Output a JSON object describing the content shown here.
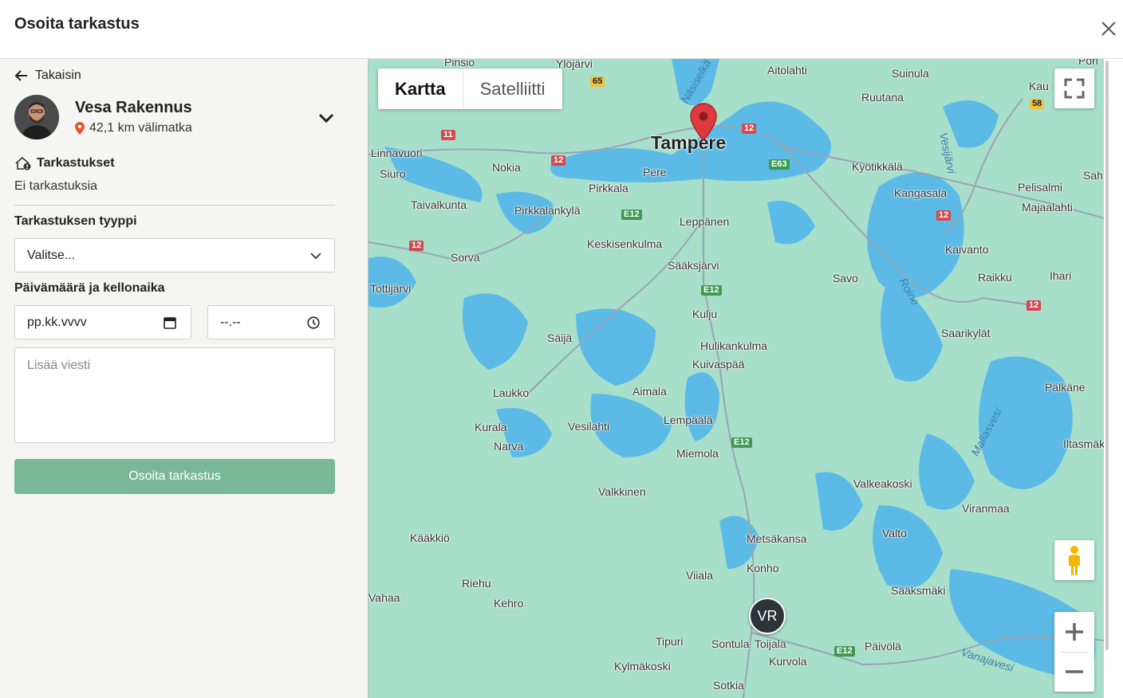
{
  "modal": {
    "title": "Osoita tarkastus"
  },
  "back": {
    "label": "Takaisin"
  },
  "profile": {
    "name": "Vesa Rakennus",
    "distance": "42,1 km välimatka"
  },
  "inspections": {
    "heading": "Tarkastukset",
    "empty_text": "Ei tarkastuksia"
  },
  "form": {
    "type_label": "Tarkastuksen tyyppi",
    "type_value": "Valitse...",
    "datetime_label": "Päivämäärä ja kellonaika",
    "date_placeholder": "pp.kk.vvvv",
    "time_placeholder": "--.--",
    "message_placeholder": "Lisää viesti",
    "submit_label": "Osoita tarkastus"
  },
  "map": {
    "tab_map": "Kartta",
    "tab_satellite": "Satelliitti",
    "marker_initials": "VR",
    "place_labels": [
      "Pinsio",
      "Ylöjärvi",
      "Aitolahti",
      "Suinula",
      "Ruutana",
      "Tampere",
      "Linnavuori",
      "Nokia",
      "Pere",
      "Kyötikkälä",
      "Siuro",
      "Pirkkala",
      "Kangasala",
      "Pelisalmi",
      "Majaalahti",
      "Taivalkunta",
      "Pirkkalankylä",
      "Leppänen",
      "Keskisenkulma",
      "Kaivanto",
      "Sorva",
      "Sääksjärvi",
      "Savo",
      "Raikku",
      "Ihari",
      "Tottijärvi",
      "Kulju",
      "Saarikylät",
      "Säijä",
      "Hulikankulma",
      "Kuivaspää",
      "Laukko",
      "Aimala",
      "Pälkäne",
      "Lempäälä",
      "Kurala",
      "Vesilahti",
      "Narva",
      "Miemola",
      "Iltasmäki",
      "Valkeakoski",
      "Valkkinen",
      "Viranmaa",
      "Kääkkiö",
      "Valto",
      "Metsäkansa",
      "Konho",
      "Viiala",
      "Riehu",
      "Sääksmäki",
      "Kehro",
      "Vahaa",
      "Tipuri",
      "Sontula",
      "Toijala",
      "Päivölä",
      "Kurvola",
      "Kylmäkoski",
      "Sotkia",
      "Sah",
      "Kau",
      "Pori"
    ],
    "water_labels": [
      "Näsiselkä",
      "Vesijärvi",
      "Roine",
      "Mallasvesi",
      "Vanajavesi"
    ],
    "road_shields": [
      "65",
      "12",
      "11",
      "12",
      "E63",
      "E12",
      "58",
      "12",
      "12",
      "12",
      "E12",
      "E12",
      "E12"
    ]
  },
  "colors": {
    "accent": "#78b899",
    "pin": "#e0393e",
    "land": "#a7dfcb",
    "water": "#5cbbe6"
  }
}
